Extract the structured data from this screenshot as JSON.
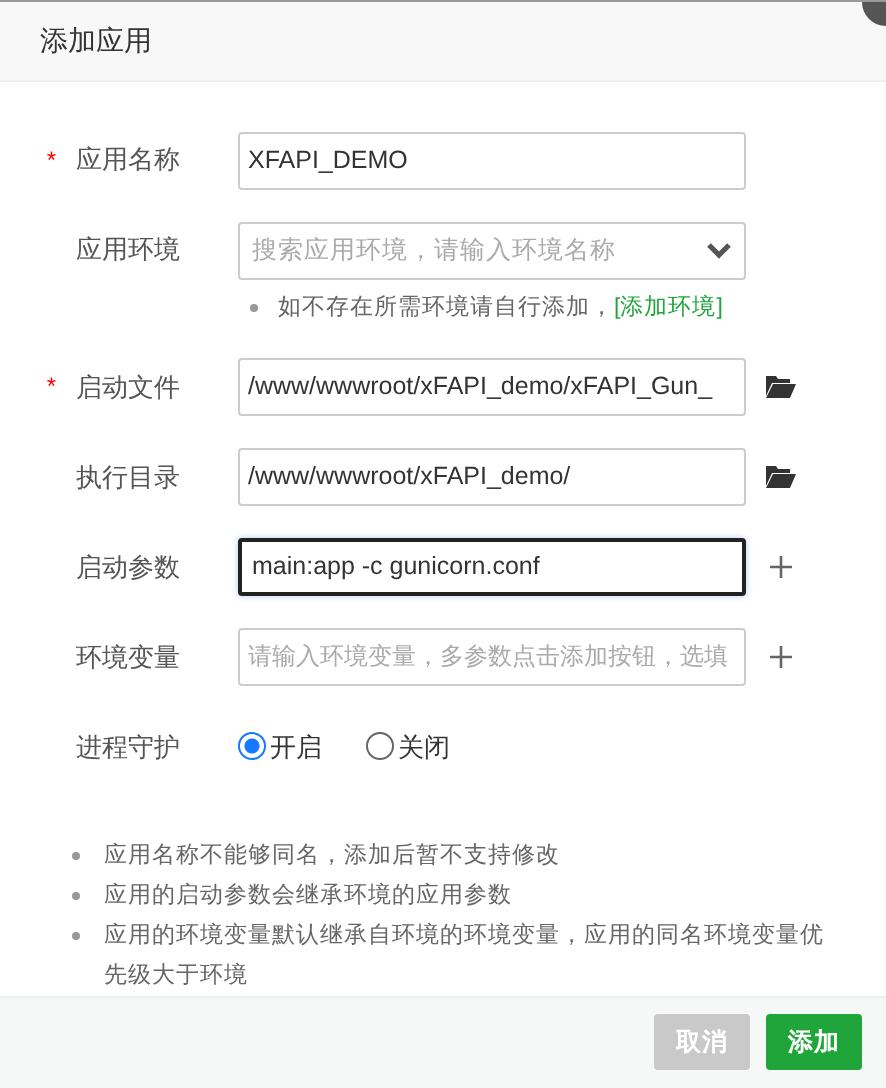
{
  "window": {
    "title": "添加应用"
  },
  "fields": [
    {
      "kind": "text",
      "label": "应用名称",
      "required_mark": "*",
      "value": "XFAPI_DEMO",
      "focused": false
    },
    {
      "kind": "select",
      "label": "应用环境",
      "placeholder": "搜索应用环境，请输入环境名称",
      "hint": "如不存在所需环境请自行添加，",
      "hint_link": "[添加环境]"
    },
    {
      "kind": "text",
      "label": "启动文件",
      "required_mark": "*",
      "value": "/www/wwwroot/xFAPI_demo/xFAPI_Gun_",
      "focused": false,
      "action": {
        "kind": "folder"
      }
    },
    {
      "kind": "text",
      "label": "执行目录",
      "value": "/www/wwwroot/xFAPI_demo/",
      "focused": false,
      "action": {
        "kind": "folder"
      }
    },
    {
      "kind": "text",
      "label": "启动参数",
      "value": "main:app -c gunicorn.conf",
      "focused": true,
      "action": {
        "kind": "plus"
      }
    },
    {
      "kind": "text",
      "label": "环境变量",
      "placeholder": "请输入环境变量，多参数点击添加按钮，选填",
      "focused": false,
      "action": {
        "kind": "plus"
      }
    },
    {
      "kind": "radio",
      "label": "进程守护",
      "options": [
        {
          "label": "开启",
          "selected": true
        },
        {
          "label": "关闭",
          "selected": false
        }
      ]
    }
  ],
  "notes": [
    "应用名称不能够同名，添加后暂不支持修改",
    "应用的启动参数会继承环境的应用参数",
    "应用的环境变量默认继承自环境的环境变量，应用的同名环境变量优先级大于环境"
  ],
  "buttons": [
    {
      "label": "取消",
      "kind": "secondary"
    },
    {
      "label": "添加",
      "kind": "primary"
    }
  ]
}
